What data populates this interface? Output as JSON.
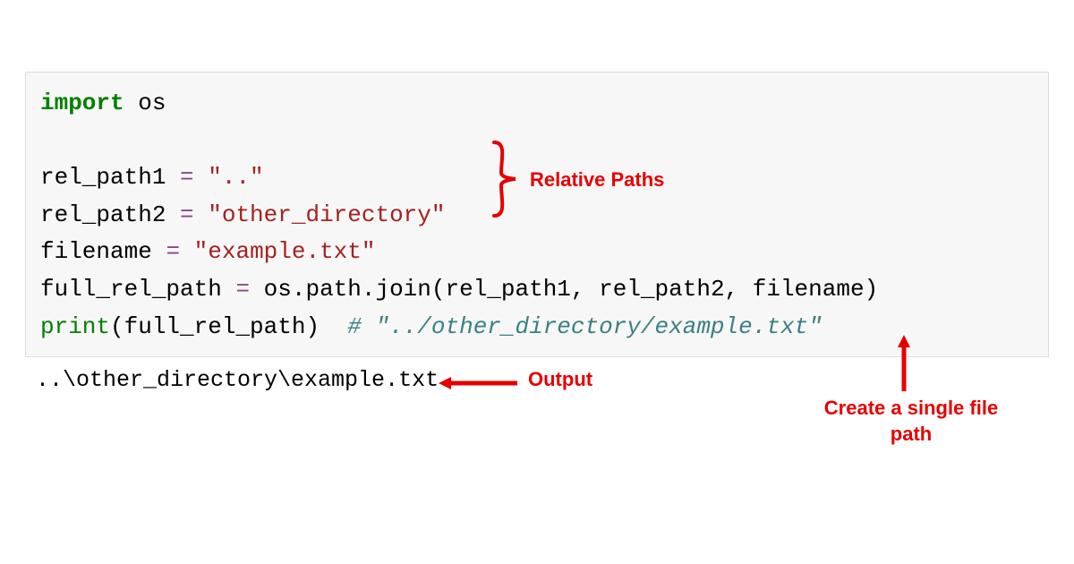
{
  "code": {
    "line1_import": "import",
    "line1_module": " os",
    "line3_var": "rel_path1 ",
    "line3_eq": "= ",
    "line3_str": "\"..\"",
    "line4_var": "rel_path2 ",
    "line4_eq": "= ",
    "line4_str": "\"other_directory\"",
    "line5_var": "filename ",
    "line5_eq": "= ",
    "line5_str": "\"example.txt\"",
    "line6_var": "full_rel_path ",
    "line6_eq": "= ",
    "line6_expr": "os.path.join(rel_path1, rel_path2, filename)",
    "line7_func": "print",
    "line7_args": "(full_rel_path)  ",
    "line7_comment": "# \"../other_directory/example.txt\""
  },
  "output": "..\\other_directory\\example.txt",
  "annotations": {
    "relative_paths": "Relative Paths",
    "output_label": "Output",
    "create_label_1": "Create a single file",
    "create_label_2": "path"
  },
  "colors": {
    "annotation_red": "#e60000",
    "code_bg": "#f7f7f7"
  }
}
